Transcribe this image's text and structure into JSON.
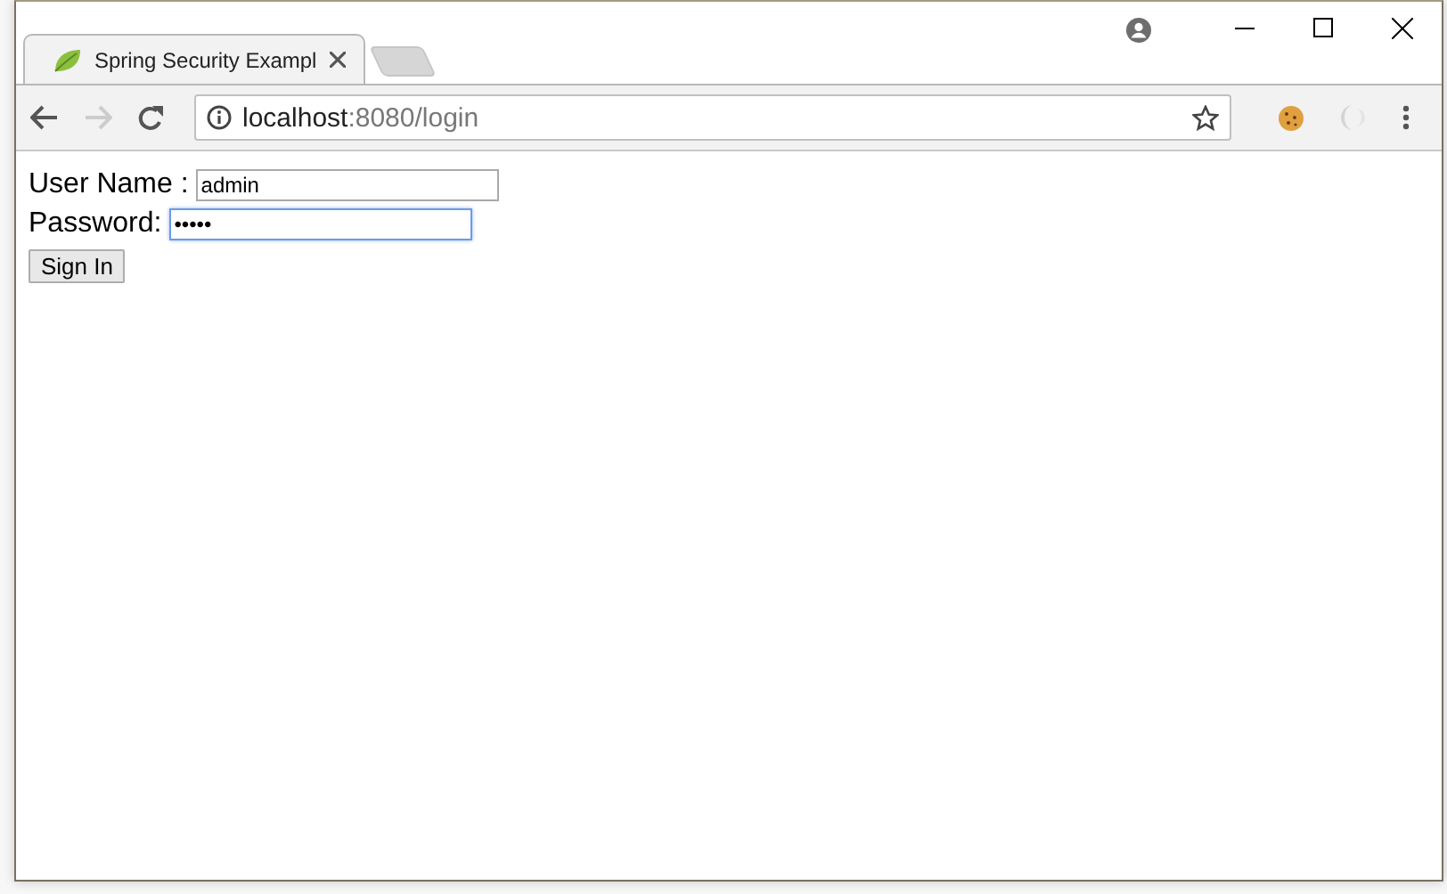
{
  "window": {
    "tabs": [
      {
        "title": "Spring Security Exampl",
        "selected": true
      }
    ],
    "address": {
      "host": "localhost",
      "path": ":8080/login"
    },
    "form": {
      "fields": [
        {
          "label": "User Name :",
          "value": "admin",
          "focused": false
        },
        {
          "label": "Password:",
          "value": "•••••",
          "focused": true
        }
      ],
      "submit": "Sign In"
    }
  }
}
